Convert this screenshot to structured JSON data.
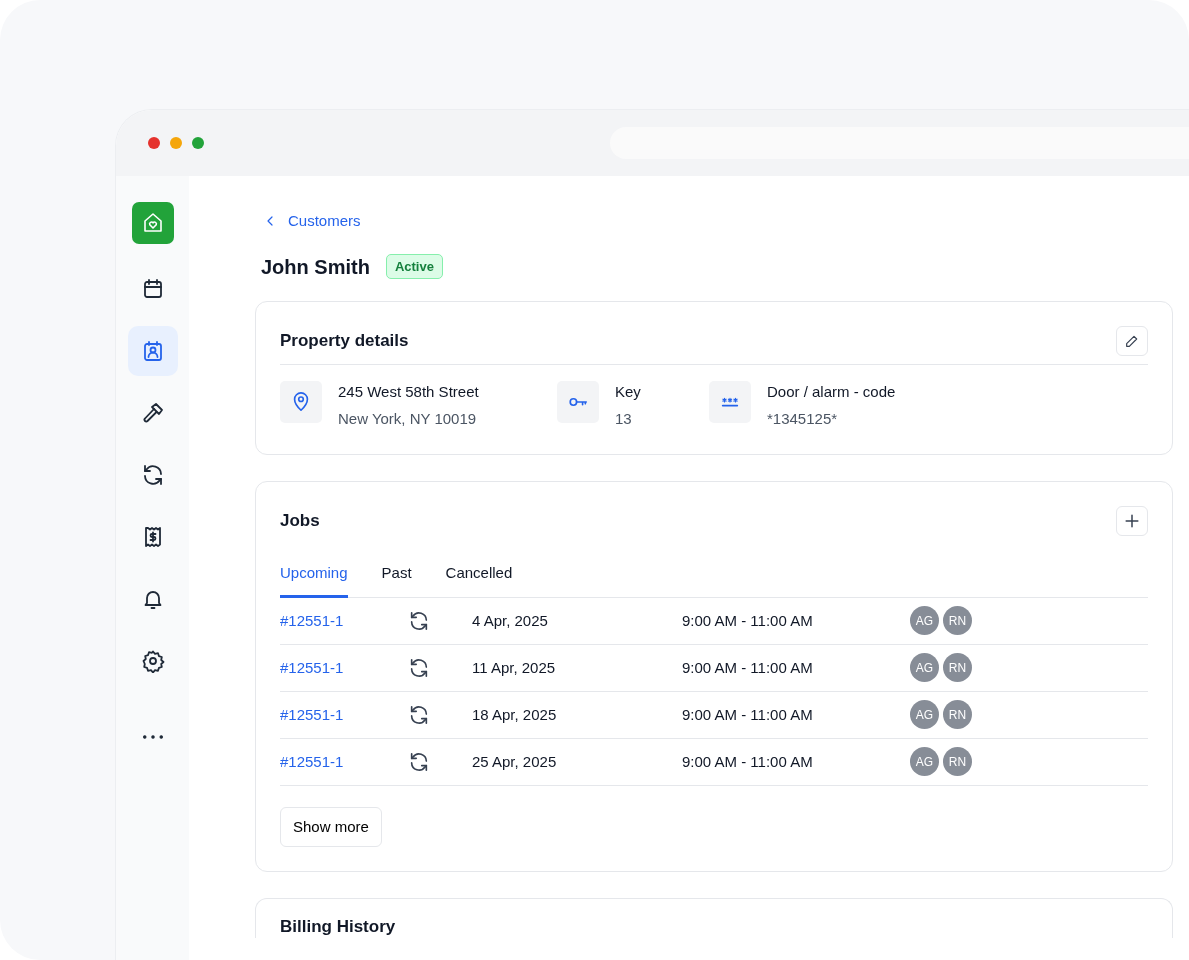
{
  "sidebar": {
    "items": [
      {
        "selected": false
      },
      {
        "selected": true
      },
      {
        "selected": false
      },
      {
        "selected": false
      },
      {
        "selected": false
      },
      {
        "selected": false
      },
      {
        "selected": false
      },
      {
        "selected": false
      }
    ]
  },
  "breadcrumb": {
    "label": "Customers"
  },
  "customer": {
    "name": "John Smith",
    "status": "Active"
  },
  "property": {
    "title": "Property details",
    "items": [
      {
        "kind": "address",
        "label": "245 West 58th Street",
        "value": "New York, NY 10019"
      },
      {
        "kind": "key",
        "label": "Key",
        "value": "13"
      },
      {
        "kind": "code",
        "label": "Door / alarm - code",
        "value": "*1345125*"
      }
    ]
  },
  "jobs": {
    "title": "Jobs",
    "tabs": [
      {
        "label": "Upcoming",
        "selected": true
      },
      {
        "label": "Past",
        "selected": false
      },
      {
        "label": "Cancelled",
        "selected": false
      }
    ],
    "rows": [
      {
        "id": "#12551-1",
        "date": "4 Apr, 2025",
        "time": "9:00 AM - 11:00 AM",
        "assignees": [
          "AG",
          "RN"
        ]
      },
      {
        "id": "#12551-1",
        "date": "11 Apr, 2025",
        "time": "9:00 AM - 11:00 AM",
        "assignees": [
          "AG",
          "RN"
        ]
      },
      {
        "id": "#12551-1",
        "date": "18 Apr, 2025",
        "time": "9:00 AM - 11:00 AM",
        "assignees": [
          "AG",
          "RN"
        ]
      },
      {
        "id": "#12551-1",
        "date": "25 Apr, 2025",
        "time": "9:00 AM - 11:00 AM",
        "assignees": [
          "AG",
          "RN"
        ]
      }
    ],
    "more_button": "Show more"
  },
  "billing": {
    "title": "Billing History"
  }
}
